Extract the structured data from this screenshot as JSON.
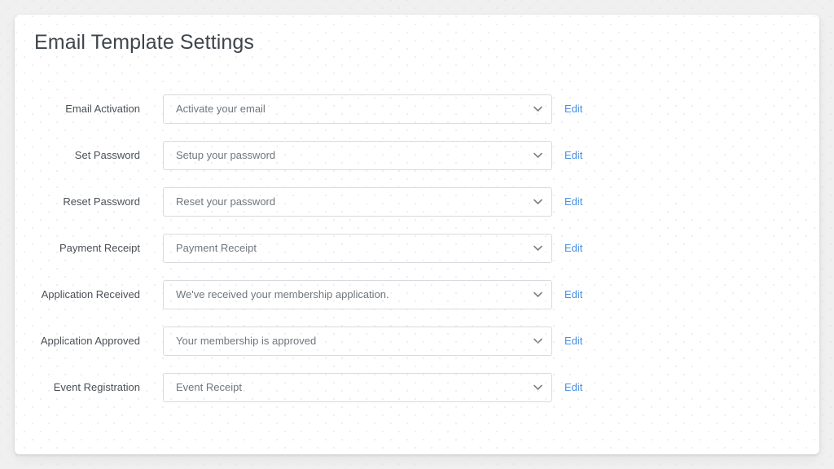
{
  "page": {
    "title": "Email Template Settings",
    "accent_link_color": "#4a90e2",
    "label_color": "#4a4f55",
    "value_color": "#6f767d",
    "card_background": "#ffffff",
    "page_background": "#f0f0f0"
  },
  "form": {
    "edit_label": "Edit",
    "dropdown_icon": "chevron-down-icon",
    "rows": [
      {
        "label": "Email Activation",
        "value": "Activate your email",
        "edit_label": "Edit"
      },
      {
        "label": "Set Password",
        "value": "Setup your password",
        "edit_label": "Edit"
      },
      {
        "label": "Reset Password",
        "value": "Reset your password",
        "edit_label": "Edit"
      },
      {
        "label": "Payment Receipt",
        "value": "Payment Receipt",
        "edit_label": "Edit"
      },
      {
        "label": "Application Received",
        "value": "We've received your membership application.",
        "edit_label": "Edit"
      },
      {
        "label": "Application Approved",
        "value": "Your membership is approved",
        "edit_label": "Edit"
      },
      {
        "label": "Event Registration",
        "value": "Event Receipt",
        "edit_label": "Edit"
      }
    ]
  }
}
